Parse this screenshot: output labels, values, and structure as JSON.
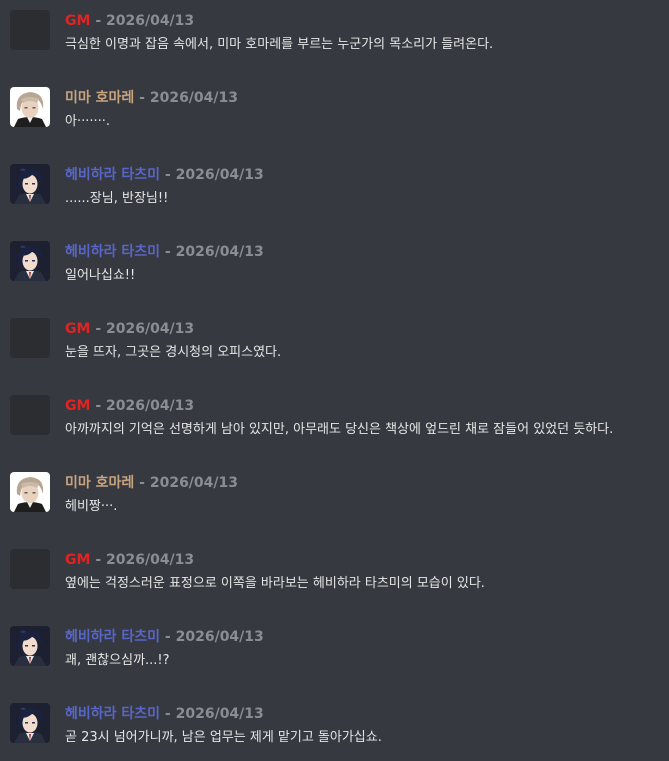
{
  "colors": {
    "background": "#36393f",
    "gm": "#e02424",
    "mima": "#c8a47e",
    "hebihara": "#5866c8",
    "timestamp": "#8a8d92",
    "text": "#e6e6e6"
  },
  "separator": "-",
  "messages": [
    {
      "author": "GM",
      "author_color": "#e02424",
      "avatar": "blank-avatar",
      "date": "2026/04/13",
      "text": "극심한 이명과 잡음 속에서, 미마 호마레를 부르는 누군가의 목소리가 들려온다."
    },
    {
      "author": "미마 호마레",
      "author_color": "#c8a47e",
      "avatar": "mima-avatar",
      "date": "2026/04/13",
      "text": "아·······."
    },
    {
      "author": "헤비하라 타츠미",
      "author_color": "#5866c8",
      "avatar": "hebihara-avatar",
      "date": "2026/04/13",
      "text": "......장님, 반장님!!"
    },
    {
      "author": "헤비하라 타츠미",
      "author_color": "#5866c8",
      "avatar": "hebihara-avatar",
      "date": "2026/04/13",
      "text": "일어나십쇼!!"
    },
    {
      "author": "GM",
      "author_color": "#e02424",
      "avatar": "blank-avatar",
      "date": "2026/04/13",
      "text": "눈을 뜨자, 그곳은 경시청의 오피스였다."
    },
    {
      "author": "GM",
      "author_color": "#e02424",
      "avatar": "blank-avatar",
      "date": "2026/04/13",
      "text": "아까까지의 기억은 선명하게 남아 있지만, 아무래도 당신은 책상에 엎드린 채로 잠들어 있었던 듯하다."
    },
    {
      "author": "미마 호마레",
      "author_color": "#c8a47e",
      "avatar": "mima-avatar",
      "date": "2026/04/13",
      "text": "헤비짱···."
    },
    {
      "author": "GM",
      "author_color": "#e02424",
      "avatar": "blank-avatar",
      "date": "2026/04/13",
      "text": "옆에는 걱정스러운 표정으로 이쪽을 바라보는 헤비하라 타츠미의 모습이 있다."
    },
    {
      "author": "헤비하라 타츠미",
      "author_color": "#5866c8",
      "avatar": "hebihara-avatar",
      "date": "2026/04/13",
      "text": "괘, 괜찮으심까...!?"
    },
    {
      "author": "헤비하라 타츠미",
      "author_color": "#5866c8",
      "avatar": "hebihara-avatar",
      "date": "2026/04/13",
      "text": "곧 23시 넘어가니까, 남은 업무는 제게 맡기고 돌아가십쇼."
    }
  ]
}
